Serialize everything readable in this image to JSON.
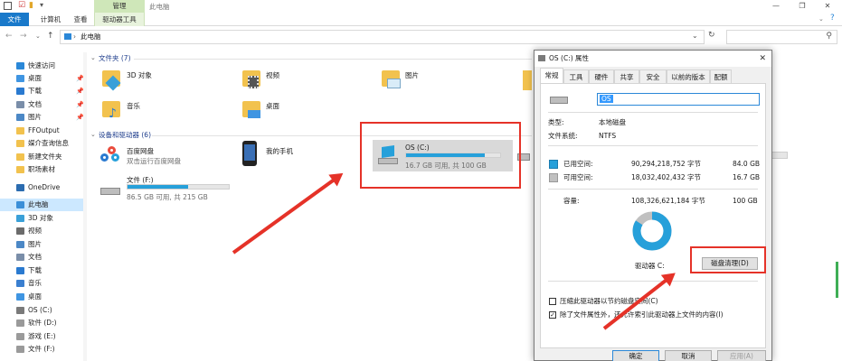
{
  "ribbon": {
    "tabs": [
      "文件",
      "计算机",
      "查看",
      "驱动器工具"
    ],
    "manage_label": "管理",
    "window_title": "此电脑"
  },
  "address": {
    "path": "此电脑"
  },
  "nav": {
    "items": [
      {
        "label": "快速访问",
        "color": "#2b88d8"
      },
      {
        "label": "桌面",
        "color": "#3f95e2",
        "pin": "📌"
      },
      {
        "label": "下载",
        "color": "#2a7ad0",
        "pin": "📌"
      },
      {
        "label": "文档",
        "color": "#7a8ea9",
        "pin": "📌"
      },
      {
        "label": "图片",
        "color": "#4c88c6",
        "pin": "📌"
      },
      {
        "label": "FFOutput",
        "color": "#f2c24e"
      },
      {
        "label": "媒介查询信息",
        "color": "#f2c24e"
      },
      {
        "label": "新建文件夹",
        "color": "#f2c24e"
      },
      {
        "label": "职场素材",
        "color": "#f2c24e"
      },
      {
        "label": "OneDrive",
        "color": "#2b6cb0"
      },
      {
        "label": "此电脑",
        "color": "#3b8fd8",
        "selected": true
      },
      {
        "label": "3D 对象",
        "color": "#3aa0d8"
      },
      {
        "label": "视频",
        "color": "#6b6b6b"
      },
      {
        "label": "图片",
        "color": "#4c88c6"
      },
      {
        "label": "文档",
        "color": "#7a8ea9"
      },
      {
        "label": "下载",
        "color": "#2a7ad0"
      },
      {
        "label": "音乐",
        "color": "#3a7fd0"
      },
      {
        "label": "桌面",
        "color": "#3f95e2"
      },
      {
        "label": "OS (C:)",
        "color": "#7a7a7a"
      },
      {
        "label": "软件 (D:)",
        "color": "#9a9a9a"
      },
      {
        "label": "游戏 (E:)",
        "color": "#9a9a9a"
      },
      {
        "label": "文件 (F:)",
        "color": "#9a9a9a"
      }
    ]
  },
  "content": {
    "folders_group": "文件夹 (7)",
    "folders": [
      "3D 对象",
      "视频",
      "图片",
      "音乐",
      "桌面"
    ],
    "devices_group": "设备和驱动器 (6)",
    "baidu": {
      "name": "百度网盘",
      "sub": "双击运行百度网盘"
    },
    "phone": {
      "name": "我的手机"
    },
    "drive_c": {
      "name": "OS (C:)",
      "free": "16.7 GB 可用, 共 100 GB",
      "used": 0.84
    },
    "drive_f": {
      "name": "文件 (F:)",
      "free": "86.5 GB 可用, 共 215 GB",
      "used": 0.6
    }
  },
  "dialog": {
    "title": "OS (C:) 属性",
    "tabs": [
      "常规",
      "工具",
      "硬件",
      "共享",
      "安全",
      "以前的版本",
      "配额"
    ],
    "name_value": "OS",
    "type_label": "类型:",
    "type_value": "本地磁盘",
    "fs_label": "文件系统:",
    "fs_value": "NTFS",
    "used_label": "已用空间:",
    "used_bytes": "90,294,218,752 字节",
    "used_gb": "84.0 GB",
    "free_label": "可用空间:",
    "free_bytes": "18,032,402,432 字节",
    "free_gb": "16.7 GB",
    "cap_label": "容量:",
    "cap_bytes": "108,326,621,184 字节",
    "cap_gb": "100 GB",
    "drive_label": "驱动器 C:",
    "cleanup_button": "磁盘清理(D)",
    "compress_label": "压缩此驱动器以节约磁盘空间(C)",
    "index_label": "除了文件属性外，还允许索引此驱动器上文件的内容(I)",
    "ok": "确定",
    "cancel": "取消",
    "apply": "应用(A)",
    "used_color": "#26a0da",
    "free_color": "#c0c0c0",
    "used_fraction": 0.84
  }
}
